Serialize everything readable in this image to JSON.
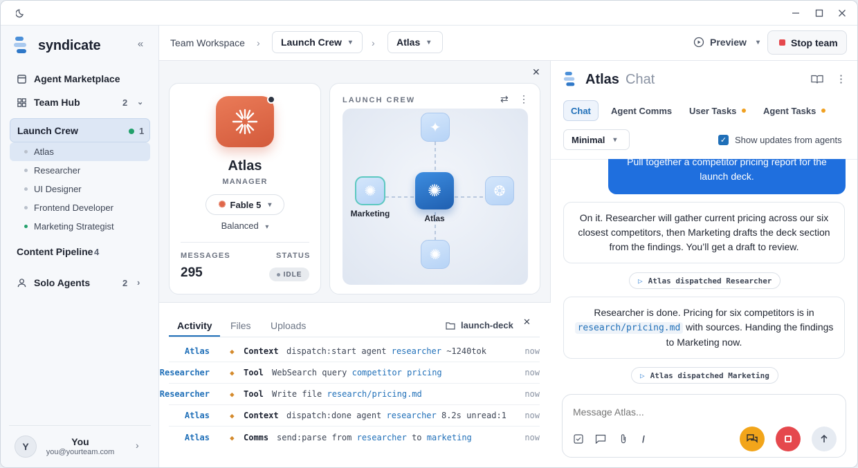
{
  "window": {
    "theme_icon": "moon-icon",
    "controls": [
      "minimize-icon",
      "maximize-icon",
      "close-icon"
    ]
  },
  "sidebar": {
    "brand": "syndicate",
    "nav": {
      "marketplace": "Agent Marketplace",
      "team_hub": "Team Hub",
      "team_hub_count": "2",
      "launch_crew": "Launch Crew",
      "launch_crew_count": "1",
      "members": [
        {
          "label": "Atlas",
          "active": true
        },
        {
          "label": "Researcher"
        },
        {
          "label": "UI Designer"
        },
        {
          "label": "Frontend Developer"
        },
        {
          "label": "Marketing Strategist",
          "online": true
        }
      ],
      "content_pipeline": "Content Pipeline",
      "content_pipeline_count": "4",
      "solo_agents": "Solo Agents",
      "solo_agents_count": "2"
    },
    "user": {
      "initial": "Y",
      "name": "You",
      "email": "you@yourteam.com"
    }
  },
  "header": {
    "breadcrumb": "Team Workspace",
    "team_select": "Launch Crew",
    "agent_select": "Atlas",
    "preview": "Preview",
    "stop": "Stop team"
  },
  "agent_card": {
    "name": "Atlas",
    "role": "MANAGER",
    "model": "Fable 5",
    "mode": "Balanced",
    "messages_label": "MESSAGES",
    "messages": "295",
    "status_label": "STATUS",
    "status": "IDLE"
  },
  "team_map": {
    "title": "LAUNCH CREW",
    "center_label": "Atlas",
    "left_label": "Marketing"
  },
  "bottom": {
    "tabs": [
      "Activity",
      "Files",
      "Uploads"
    ],
    "folder": "launch-deck",
    "rows": [
      {
        "who": "Atlas",
        "kind": "Context",
        "pre": "dispatch:start agent ",
        "hl": "researcher",
        "post": " ~1240tok",
        "time": "now"
      },
      {
        "who": "Researcher",
        "kind": "Tool",
        "pre": "WebSearch query ",
        "hl": "competitor pricing",
        "post": "",
        "time": "now"
      },
      {
        "who": "Researcher",
        "kind": "Tool",
        "pre": "Write file ",
        "hl": "research/pricing.md",
        "post": "",
        "time": "now"
      },
      {
        "who": "Atlas",
        "kind": "Context",
        "pre": "dispatch:done agent ",
        "hl": "researcher",
        "post": " 8.2s unread:1",
        "time": "now"
      },
      {
        "who": "Atlas",
        "kind": "Comms",
        "pre": "send:parse from ",
        "hl": "researcher",
        "mid": " to ",
        "hl2": "marketing",
        "post": "",
        "time": "now"
      }
    ]
  },
  "chat": {
    "title": "Atlas",
    "subtitle": "Chat",
    "tabs": {
      "chat": "Chat",
      "agent_comms": "Agent Comms",
      "user_tasks": "User Tasks",
      "agent_tasks": "Agent Tasks"
    },
    "verbosity": "Minimal",
    "show_updates": "Show updates from agents",
    "user_msg": "Pull together a competitor pricing report for the launch deck.",
    "msg1": "On it. Researcher will gather current pricing across our six closest competitors, then Marketing drafts the deck section from the findings. You’ll get a draft to review.",
    "pill1": "Atlas dispatched Researcher",
    "msg2_a": "Researcher is done. Pricing for six competitors is in",
    "msg2_code": "research/pricing.md",
    "msg2_b": " with sources. Handing the findings to Marketing now.",
    "pill2": "Atlas dispatched Marketing",
    "placeholder": "Message Atlas..."
  },
  "colors": {
    "accent": "#1f6fb8",
    "stop": "#e5484d",
    "agent_orange": "#e0674a",
    "online": "#22a06b",
    "warn": "#f0a020"
  }
}
